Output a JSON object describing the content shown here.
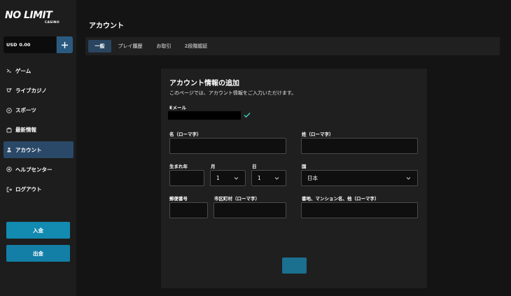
{
  "brand": {
    "logo_main": "NO LIMIT",
    "logo_sub": "CASINO"
  },
  "balance": {
    "currency": "USD",
    "amount": "0.00"
  },
  "nav": [
    {
      "label": "ゲーム",
      "icon": "gamepad-icon",
      "active": false
    },
    {
      "label": "ライブカジノ",
      "icon": "chip-icon",
      "active": false
    },
    {
      "label": "スポーツ",
      "icon": "soccer-ball-icon",
      "active": false
    },
    {
      "label": "最新情報",
      "icon": "news-icon",
      "active": false
    },
    {
      "label": "アカウント",
      "icon": "user-icon",
      "active": true
    },
    {
      "label": "ヘルプセンター",
      "icon": "chat-icon",
      "active": false
    },
    {
      "label": "ログアウト",
      "icon": "logout-icon",
      "active": false
    }
  ],
  "actions": {
    "deposit": "入金",
    "withdraw": "出金"
  },
  "page": {
    "title": "アカウント"
  },
  "tabs": [
    "一般",
    "プレイ履歴",
    "お取引",
    "2段階認証"
  ],
  "form": {
    "title": "アカウント情報の追加",
    "description": "このページでは、アカウント情報をご入力いただけます。",
    "email_label": "Eメール",
    "first_name_label": "名（ローマ字）",
    "last_name_label": "姓（ローマ字）",
    "birth_year_label": "生まれ年",
    "month_label": "月",
    "month_value": "1",
    "day_label": "日",
    "day_value": "1",
    "country_label": "国",
    "country_value": "日本",
    "postal_label": "郵便番号",
    "city_label": "市区町村（ローマ字）",
    "address_label": "番地、マンション名、他（ローマ字）"
  },
  "colors": {
    "accent": "#138ab0",
    "active_nav": "#2a4968",
    "check": "#3ec9b8"
  }
}
